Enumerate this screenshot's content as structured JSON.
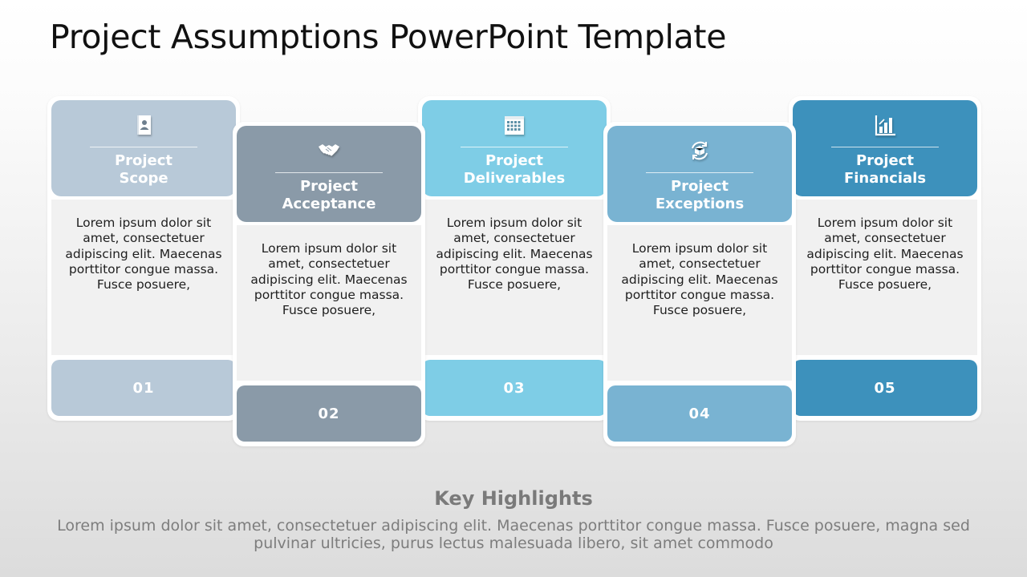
{
  "title": "Project Assumptions PowerPoint Template",
  "cards": [
    {
      "title_line1": "Project",
      "title_line2": "Scope",
      "icon": "profile-card-icon",
      "body": "Lorem ipsum dolor sit amet, consectetuer adipiscing elit. Maecenas porttitor congue massa. Fusce posuere,",
      "number": "01",
      "color": "#b8c9d8"
    },
    {
      "title_line1": "Project",
      "title_line2": "Acceptance",
      "icon": "handshake-icon",
      "body": "Lorem ipsum dolor sit amet, consectetuer adipiscing elit. Maecenas porttitor congue massa. Fusce posuere,",
      "number": "02",
      "color": "#8a9aa8"
    },
    {
      "title_line1": "Project",
      "title_line2": "Deliverables",
      "icon": "calendar-icon",
      "body": "Lorem ipsum dolor sit amet, consectetuer adipiscing elit. Maecenas porttitor congue massa. Fusce posuere,",
      "number": "03",
      "color": "#7ecde6"
    },
    {
      "title_line1": "Project",
      "title_line2": "Exceptions",
      "icon": "package-cycle-icon",
      "body": "Lorem ipsum dolor sit amet, consectetuer adipiscing elit. Maecenas porttitor congue massa. Fusce posuere,",
      "number": "04",
      "color": "#79b3d2"
    },
    {
      "title_line1": "Project",
      "title_line2": "Financials",
      "icon": "bar-chart-icon",
      "body": "Lorem ipsum dolor sit amet, consectetuer adipiscing elit. Maecenas porttitor congue massa. Fusce posuere,",
      "number": "05",
      "color": "#3d91bc"
    }
  ],
  "highlights": {
    "title": "Key Highlights",
    "text": "Lorem ipsum dolor sit amet, consectetuer adipiscing elit. Maecenas porttitor congue massa. Fusce posuere, magna sed pulvinar ultricies, purus lectus malesuada libero, sit amet commodo"
  }
}
